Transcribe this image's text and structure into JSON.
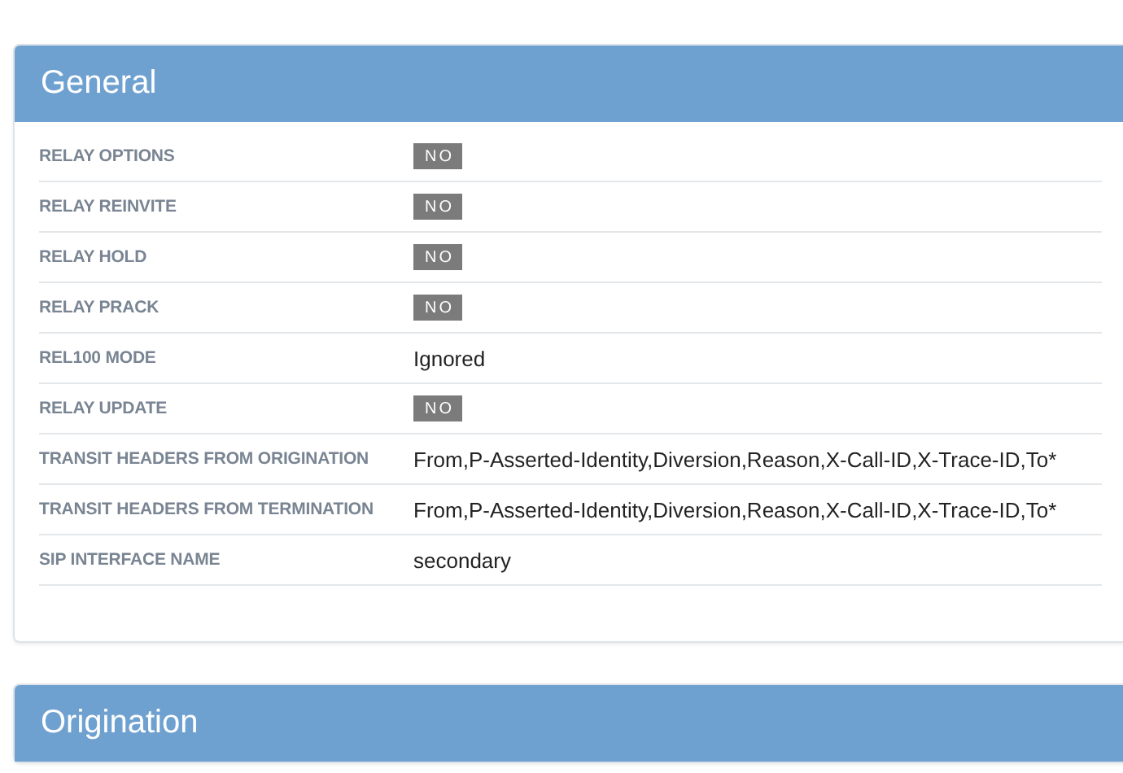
{
  "panels": [
    {
      "title": "General",
      "rows": [
        {
          "label": "RELAY OPTIONS",
          "kind": "badge",
          "value": "NO"
        },
        {
          "label": "RELAY REINVITE",
          "kind": "badge",
          "value": "NO"
        },
        {
          "label": "RELAY HOLD",
          "kind": "badge",
          "value": "NO"
        },
        {
          "label": "RELAY PRACK",
          "kind": "badge",
          "value": "NO"
        },
        {
          "label": "REL100 MODE",
          "kind": "text",
          "value": "Ignored"
        },
        {
          "label": "RELAY UPDATE",
          "kind": "badge",
          "value": "NO"
        },
        {
          "label": "TRANSIT HEADERS FROM ORIGINATION",
          "kind": "text",
          "value": "From,P-Asserted-Identity,Diversion,Reason,X-Call-ID,X-Trace-ID,To*"
        },
        {
          "label": "TRANSIT HEADERS FROM TERMINATION",
          "kind": "text",
          "value": "From,P-Asserted-Identity,Diversion,Reason,X-Call-ID,X-Trace-ID,To*"
        },
        {
          "label": "SIP INTERFACE NAME",
          "kind": "text",
          "value": "secondary"
        }
      ]
    },
    {
      "title": "Origination"
    }
  ]
}
